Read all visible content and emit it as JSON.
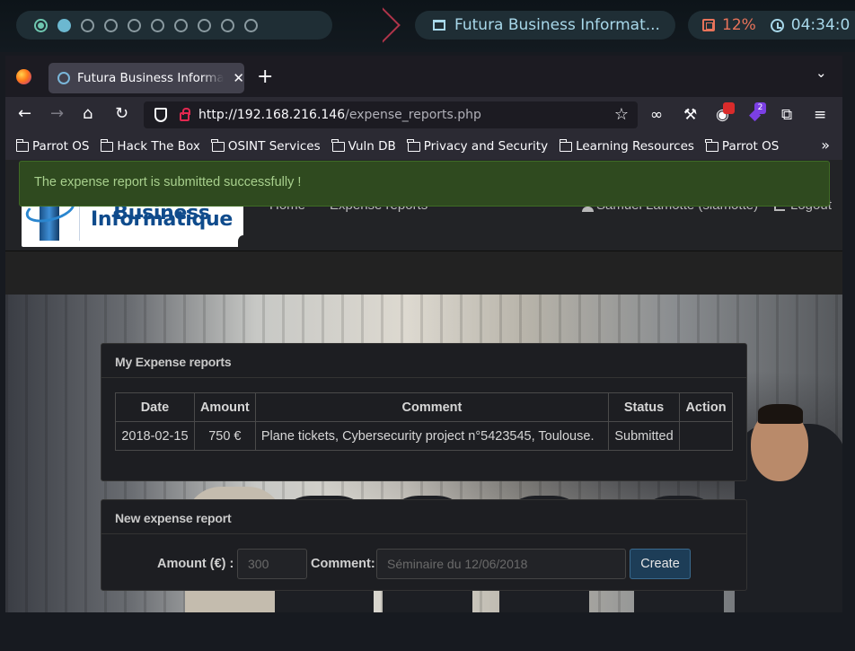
{
  "desktop": {
    "window_title": "Futura Business Informat...",
    "cpu": "12%",
    "clock": "04:34:0"
  },
  "browser": {
    "tab_title": "Futura Business Informatique",
    "url_host": "http://192.168.216.146",
    "url_path": "/expense_reports.php",
    "extension_badge": "2",
    "bookmarks": [
      "Parrot OS",
      "Hack The Box",
      "OSINT Services",
      "Vuln DB",
      "Privacy and Security",
      "Learning Resources",
      "Parrot OS"
    ]
  },
  "site": {
    "logo_line1": "Futura Business",
    "logo_line2": "Informatique",
    "nav_home": "Home",
    "nav_expense": "Expense reports",
    "user": "Samuel Lamotte (slamotte)",
    "logout": "Logout",
    "alert": "The expense report is submitted successfully !",
    "reports": {
      "title": "My Expense reports",
      "columns": [
        "Date",
        "Amount",
        "Comment",
        "Status",
        "Action"
      ],
      "rows": [
        {
          "date": "2018-02-15",
          "amount": "750 €",
          "comment": "Plane tickets, Cybersecurity project n°5423545, Toulouse.",
          "status": "Submitted",
          "action": ""
        }
      ]
    },
    "new_report": {
      "title": "New expense report",
      "amount_label": "Amount (€) :",
      "amount_placeholder": "300",
      "comment_label": "Comment:",
      "comment_placeholder": "Séminaire du 12/06/2018",
      "create_label": "Create"
    }
  },
  "colors": {
    "alert_bg": "#2f4a1f",
    "alert_text": "#a8d08d",
    "logo_blue": "#0f4b8c",
    "create_btn": "#1d3d57"
  }
}
